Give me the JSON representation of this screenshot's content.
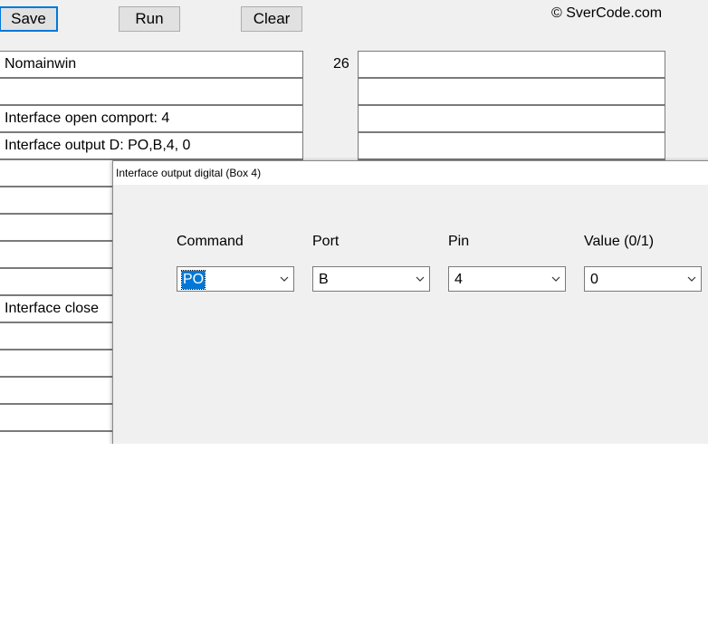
{
  "toolbar": {
    "save_label": "Save",
    "run_label": "Run",
    "clear_label": "Clear"
  },
  "copyright": "© SverCode.com",
  "counter": "26",
  "left_rows": [
    "Nomainwin",
    "",
    "Interface open comport: 4",
    "Interface output D: PO,B,4, 0",
    "",
    "",
    "",
    "",
    "",
    "Interface close",
    "",
    "",
    "",
    "",
    ""
  ],
  "right_rows": [
    "",
    "",
    "",
    "",
    ""
  ],
  "dialog": {
    "title": "Interface output digital (Box 4)",
    "fields": [
      {
        "label": "Command",
        "value": "PO"
      },
      {
        "label": "Port",
        "value": "B"
      },
      {
        "label": "Pin",
        "value": "4"
      },
      {
        "label": "Value (0/1)",
        "value": "0"
      }
    ]
  },
  "icons": {
    "combo_arrow": "chevron-down-icon"
  }
}
